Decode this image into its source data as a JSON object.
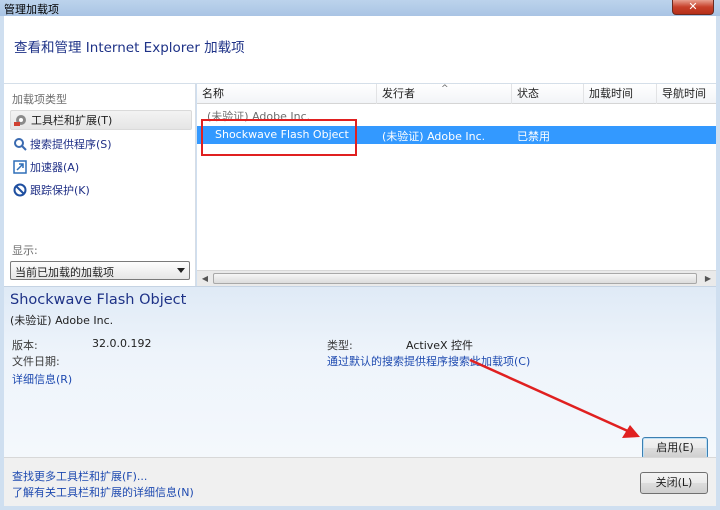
{
  "window": {
    "title": "管理加载项",
    "close_label": "✕"
  },
  "header": {
    "text": "查看和管理 Internet Explorer 加载项"
  },
  "sidebar": {
    "section_label": "加载项类型",
    "items": [
      {
        "label": "工具栏和扩展(T)",
        "icon": "gear-icon"
      },
      {
        "label": "搜索提供程序(S)",
        "icon": "search-icon"
      },
      {
        "label": "加速器(A)",
        "icon": "accelerator-icon"
      },
      {
        "label": "跟踪保护(K)",
        "icon": "block-icon"
      }
    ],
    "show_label": "显示:",
    "show_value": "当前已加载的加载项"
  },
  "list": {
    "columns": [
      "名称",
      "发行者",
      "状态",
      "加载时间",
      "导航时间"
    ],
    "group": "(未验证) Adobe Inc.",
    "rows": [
      {
        "name": "Shockwave Flash Object",
        "publisher": "(未验证) Adobe Inc.",
        "status": "已禁用"
      }
    ]
  },
  "details": {
    "name": "Shockwave Flash Object",
    "publisher": "(未验证) Adobe Inc.",
    "version_label": "版本:",
    "version_value": "32.0.0.192",
    "filedate_label": "文件日期:",
    "more_info": "详细信息(R)",
    "type_label": "类型:",
    "type_value": "ActiveX 控件",
    "search_link": "通过默认的搜索提供程序搜索此加载项(C)",
    "enable_button": "启用(E)"
  },
  "footer": {
    "link1": "查找更多工具栏和扩展(F)...",
    "link2": "了解有关工具栏和扩展的详细信息(N)",
    "close_button": "关闭(L)"
  },
  "colors": {
    "accent": "#3399ff",
    "annotation": "#e02020",
    "link": "#1e4ab0"
  }
}
